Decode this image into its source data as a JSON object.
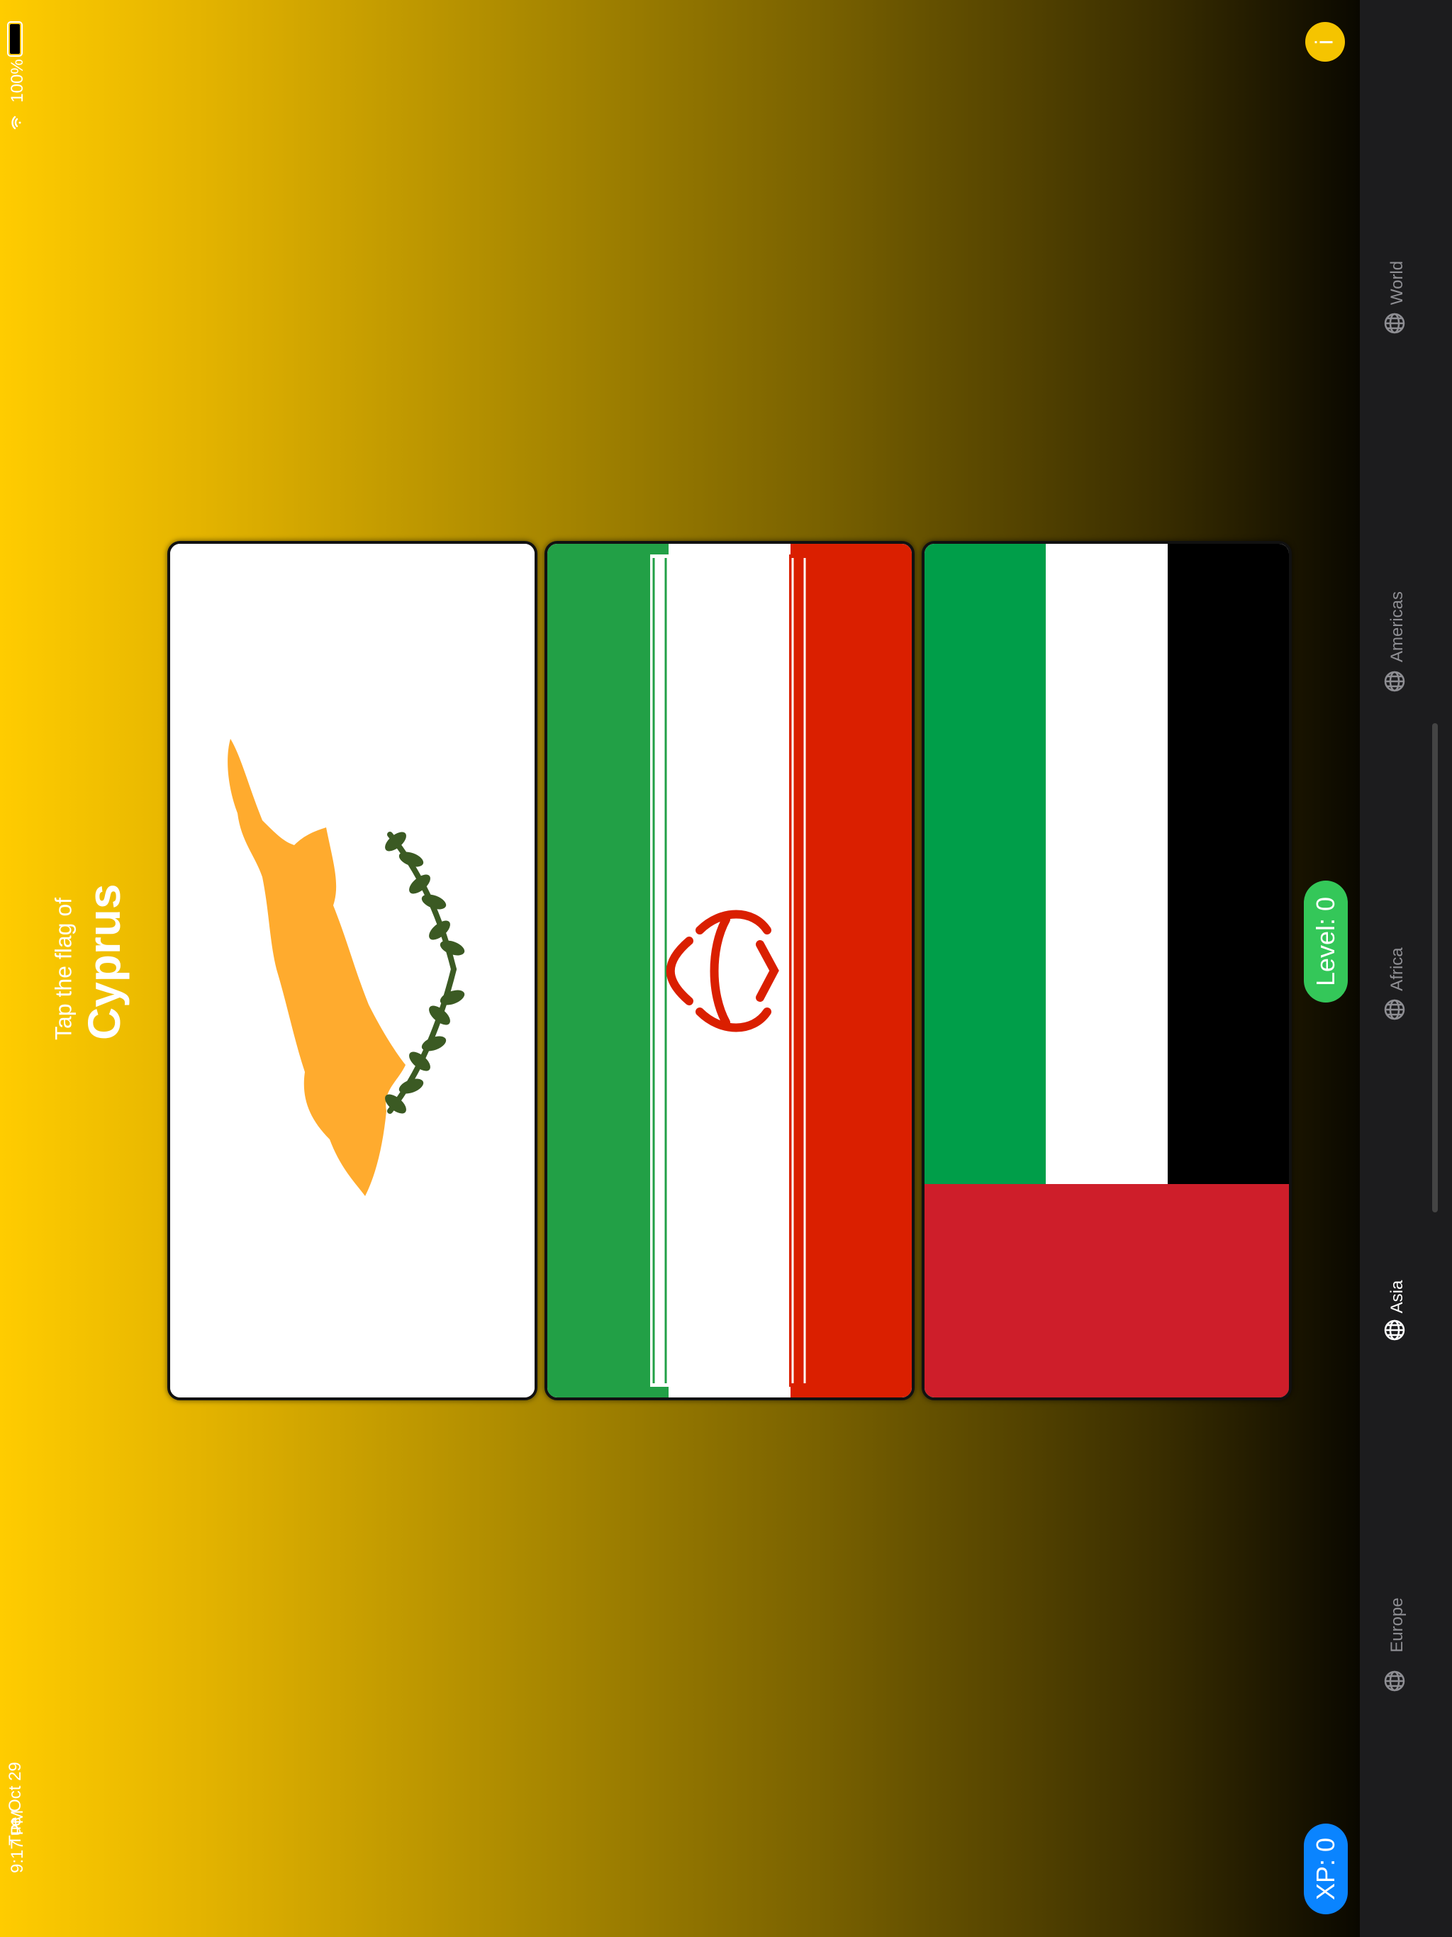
{
  "status_bar": {
    "time": "9:17 PM",
    "date": "Tue Oct 29",
    "battery": "100%",
    "wifi_icon": "wifi-icon",
    "battery_icon": "battery-icon"
  },
  "prompt": {
    "instruction": "Tap the flag of",
    "country": "Cyprus"
  },
  "flags": [
    {
      "country": "Cyprus",
      "colors": {
        "field": "#ffffff",
        "island": "#ffab2e",
        "branches": "#3b5a23"
      }
    },
    {
      "country": "Iran",
      "colors": {
        "green": "#22a046",
        "white": "#ffffff",
        "red": "#da1f00",
        "emblem": "#da1f00"
      }
    },
    {
      "country": "Kuwait",
      "colors": {
        "green": "#009e49",
        "white": "#ffffff",
        "red": "#ce1e2a",
        "black": "#000000"
      }
    }
  ],
  "badges": {
    "level": "Level: 0",
    "xp": "XP: 0",
    "level_color": "#34c759",
    "xp_color": "#0a84ff"
  },
  "info_button": {
    "label": "i"
  },
  "tabs": [
    {
      "label": "Europe",
      "icon": "globe-icon",
      "active": false
    },
    {
      "label": "Asia",
      "icon": "globe-icon",
      "active": true
    },
    {
      "label": "Africa",
      "icon": "globe-icon",
      "active": false
    },
    {
      "label": "Americas",
      "icon": "globe-icon",
      "active": false
    },
    {
      "label": "World",
      "icon": "globe-icon",
      "active": false
    }
  ]
}
